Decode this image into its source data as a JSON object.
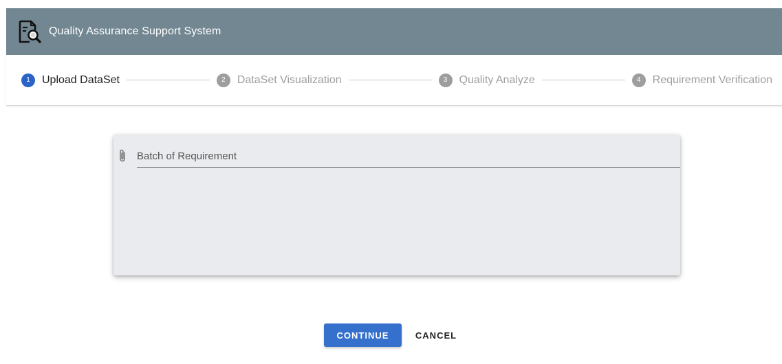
{
  "app": {
    "title": "Quality Assurance Support System",
    "logo_icon": "document-search-icon",
    "bar_color": "#728792"
  },
  "stepper": {
    "accent_color": "#2a64c8",
    "inactive_color": "#9e9e9e",
    "steps": [
      {
        "number": "1",
        "label": "Upload DataSet",
        "active": true
      },
      {
        "number": "2",
        "label": "DataSet Visualization",
        "active": false
      },
      {
        "number": "3",
        "label": "Quality Analyze",
        "active": false
      },
      {
        "number": "4",
        "label": "Requirement Verification",
        "active": false
      }
    ]
  },
  "upload": {
    "icon": "paperclip-icon",
    "field_label": "Batch of Requirement"
  },
  "actions": {
    "continue_label": "CONTINUE",
    "cancel_label": "CANCEL",
    "continue_color": "#3470cc"
  }
}
